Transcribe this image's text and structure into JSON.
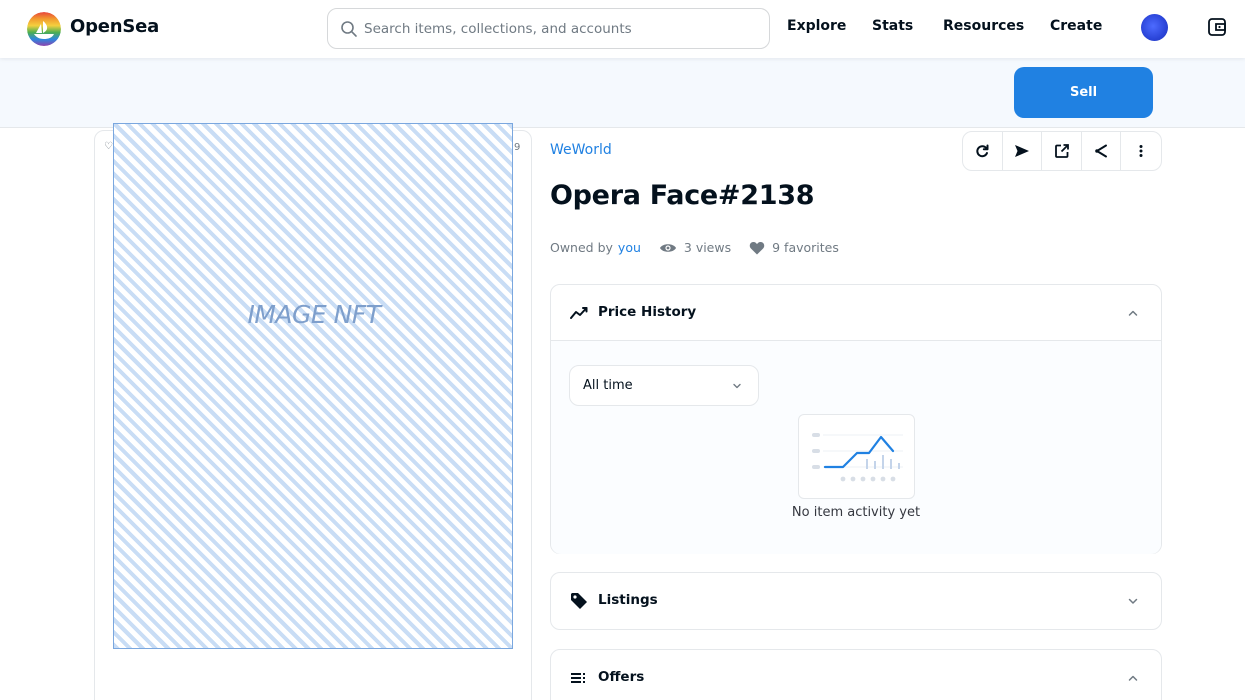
{
  "header": {
    "brand": "OpenSea",
    "search_placeholder": "Search items, collections, and accounts",
    "nav": [
      "Explore",
      "Stats",
      "Resources",
      "Create"
    ]
  },
  "sell_button": "Sell",
  "image_card": {
    "left_mini": "♡",
    "right_mini": "9",
    "placeholder_text": "IMAGE NFT"
  },
  "item": {
    "collection": "WeWorld",
    "title": "Opera Face#2138",
    "owned_by_label": "Owned by",
    "owner": "you",
    "views": "3 views",
    "favorites": "9 favorites"
  },
  "toolbar": {
    "icons": [
      "refresh-icon",
      "transfer-icon",
      "external-link-icon",
      "share-icon",
      "more-icon"
    ]
  },
  "price_history": {
    "title": "Price History",
    "range": "All time",
    "empty_text": "No item activity yet",
    "expanded": true
  },
  "listings": {
    "title": "Listings",
    "expanded": false
  },
  "offers": {
    "title": "Offers",
    "expanded": true
  },
  "colors": {
    "accent": "#2081e2",
    "text": "#04111d",
    "muted": "#707a83",
    "border": "#e5e8eb"
  }
}
